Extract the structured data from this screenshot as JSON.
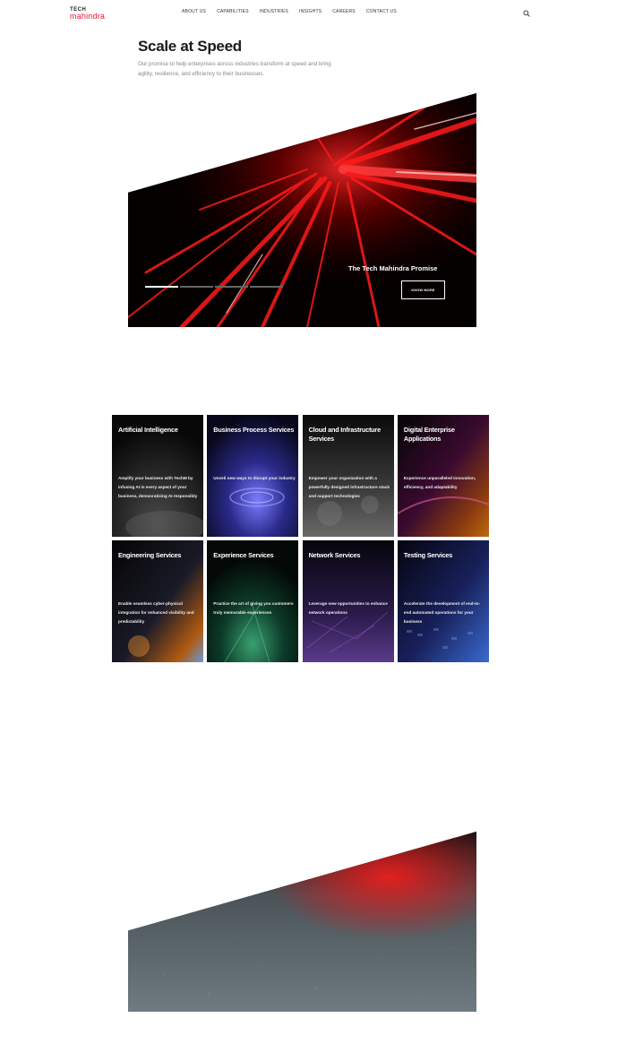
{
  "header": {
    "logo": {
      "line1": "TECH",
      "line2": "mahindra"
    },
    "nav": [
      "ABOUT US",
      "CAPABILITIES",
      "INDUSTRIES",
      "INSIGHTS",
      "CAREERS",
      "CONTACT US"
    ],
    "search_icon": "search-icon"
  },
  "hero": {
    "title": "Scale at Speed",
    "description": "Our promise to help enterprises across industries transform at speed and bring agility, resilience, and efficiency to their businesses.",
    "banner_label": "The Tech Mahindra Promise",
    "button": "KNOW MORE",
    "slides_count": 4,
    "active_slide": 1
  },
  "capabilities": [
    {
      "title": "Artificial Intelligence",
      "desc": "Amplify your business with TechM by infusing AI in every aspect of your business, democratizing AI responsibly"
    },
    {
      "title": "Business Process Services",
      "desc": "Unveil new ways to disrupt your industry"
    },
    {
      "title": "Cloud and Infrastructure Services",
      "desc": "Empower your organization with a powerfully designed infrastructure stack and support technologies"
    },
    {
      "title": "Digital Enterprise Applications",
      "desc": "Experience unparalleled innovation, efficiency, and adaptability"
    },
    {
      "title": "Engineering Services",
      "desc": "Enable seamless cyber-physical integration for enhanced visibility and predictability"
    },
    {
      "title": "Experience Services",
      "desc": "Practice the art of giving you customers truly memorable experiences"
    },
    {
      "title": "Network Services",
      "desc": "Leverage new opportunities to enhance network operations"
    },
    {
      "title": "Testing Services",
      "desc": "Accelerate the development of end-to-end automated operations for your business"
    }
  ],
  "colors": {
    "brand_red": "#e31837",
    "text_dark": "#1a1a1a",
    "text_muted": "#888888"
  }
}
